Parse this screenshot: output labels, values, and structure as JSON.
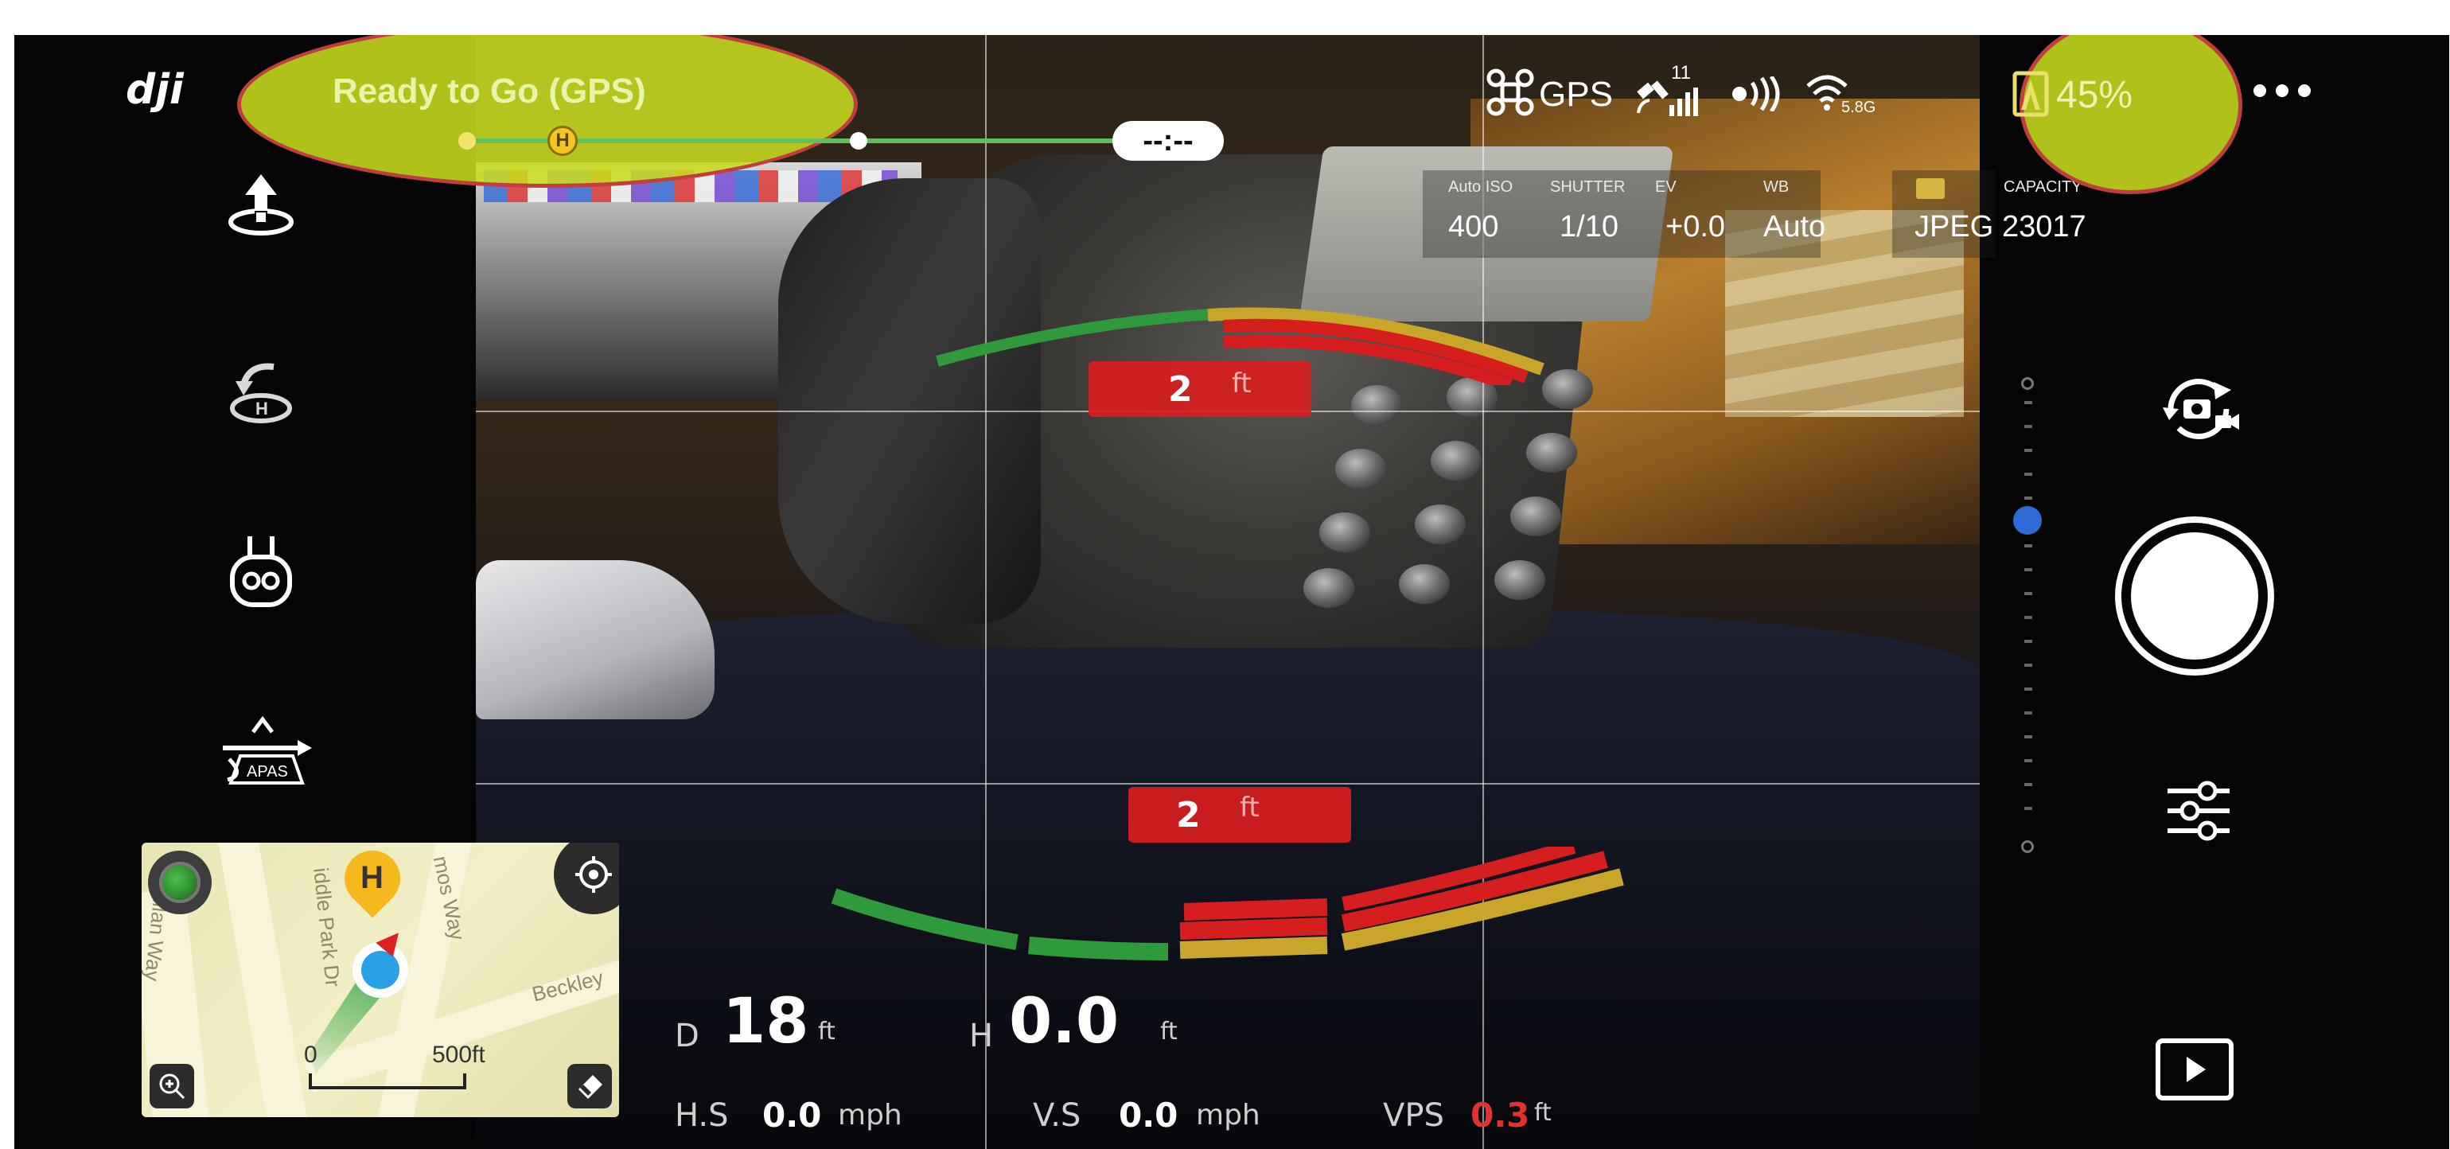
{
  "status": {
    "flight_status": "Ready to Go (GPS)",
    "gps_label": "GPS",
    "satellite_count": "11",
    "frequency": "5.8G",
    "battery": "45%",
    "flight_time": "--:--",
    "home_marker": "H"
  },
  "camera": {
    "iso_label": "Auto ISO",
    "iso_value": "400",
    "shutter_label": "SHUTTER",
    "shutter_value": "1/10",
    "ev_label": "EV",
    "ev_value": "+0.0",
    "wb_label": "WB",
    "wb_value": "Auto",
    "format_value": "JPEG",
    "capacity_label": "CAPACITY",
    "capacity_value": "23017"
  },
  "obstacle": {
    "top_distance": "2",
    "top_unit": "ft",
    "bottom_distance": "2",
    "bottom_unit": "ft"
  },
  "telemetry": {
    "d_label": "D",
    "d_value": "18",
    "d_unit": "ft",
    "h_label": "H",
    "h_value": "0.0",
    "h_unit": "ft",
    "hs_label": "H.S",
    "hs_value": "0.0",
    "hs_unit": "mph",
    "vs_label": "V.S",
    "vs_value": "0.0",
    "vs_unit": "mph",
    "vps_label": "VPS",
    "vps_value": "0.3",
    "vps_unit": "ft"
  },
  "left_menu": {
    "apas_label": "APAS"
  },
  "map": {
    "street_1": "Ellan Way",
    "street_2": "iddle Park Dr",
    "street_3": "mos Way",
    "street_4": "Beckley",
    "scale_zero": "0",
    "scale_max": "500ft",
    "home_marker": "H"
  },
  "icons": {
    "logo": "dji-logo",
    "aircraft": "aircraft-icon",
    "satellite": "satellite-icon",
    "rc_signal": "rc-signal-icon",
    "wifi": "wifi-icon",
    "battery": "battery-icon",
    "more": "more-icon",
    "takeoff": "takeoff-icon",
    "return_home": "return-home-icon",
    "remote": "remote-controller-icon",
    "apas": "apas-icon",
    "camera_switch": "camera-switch-icon",
    "shutter": "shutter-button",
    "settings": "camera-settings-icon",
    "playback": "playback-icon"
  },
  "colors": {
    "highlight": "#c8dc1e",
    "highlight_border": "#c23d3d",
    "warning_red": "#d71e1e",
    "safe_green": "#2f9a3a",
    "caution_yellow": "#c9a52a",
    "vps_red": "#e53030",
    "progress_green": "#6fd06a"
  }
}
